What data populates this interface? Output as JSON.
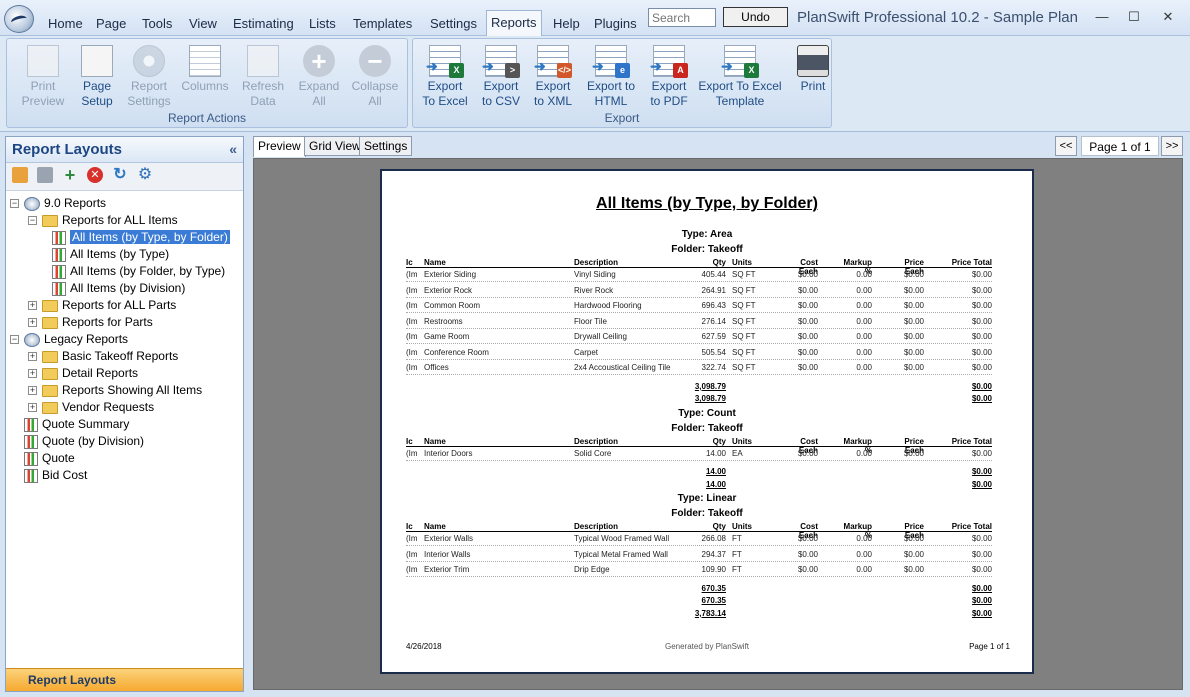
{
  "window": {
    "title": "PlanSwift Professional 10.2 - Sample Plan",
    "minimize": "—",
    "maximize": "☐",
    "close": "✕"
  },
  "menu": {
    "items": [
      "Home",
      "Page",
      "Tools",
      "View",
      "Estimating",
      "Lists",
      "Templates",
      "Settings",
      "Reports",
      "Help",
      "Plugins"
    ],
    "active": "Reports",
    "search_placeholder": "Search",
    "undo_label": "Undo"
  },
  "ribbon": {
    "report_actions": {
      "label": "Report Actions",
      "buttons": [
        {
          "label": "Print\nPreview",
          "icon": "print-preview-icon",
          "enabled": false
        },
        {
          "label": "Page\nSetup",
          "icon": "page-setup-icon",
          "enabled": true
        },
        {
          "label": "Report\nSettings",
          "icon": "report-settings-icon",
          "enabled": false
        },
        {
          "label": "Columns",
          "icon": "columns-icon",
          "enabled": false
        },
        {
          "label": "Refresh\nData",
          "icon": "refresh-data-icon",
          "enabled": false
        },
        {
          "label": "Expand\nAll",
          "icon": "expand-all-icon",
          "enabled": false
        },
        {
          "label": "Collapse\nAll",
          "icon": "collapse-all-icon",
          "enabled": false
        }
      ]
    },
    "export": {
      "label": "Export",
      "buttons": [
        {
          "label": "Export\nTo Excel",
          "icon": "export-excel-icon",
          "badge": "X"
        },
        {
          "label": "Export\nto CSV",
          "icon": "export-csv-icon",
          "badge": ">"
        },
        {
          "label": "Export\nto XML",
          "icon": "export-xml-icon",
          "badge": "</>"
        },
        {
          "label": "Export to\nHTML",
          "icon": "export-html-icon",
          "badge": "e"
        },
        {
          "label": "Export\nto PDF",
          "icon": "export-pdf-icon",
          "badge": "A"
        },
        {
          "label": "Export To Excel\nTemplate",
          "icon": "export-excel-template-icon",
          "badge": "X"
        },
        {
          "label": "Print",
          "icon": "printer-icon",
          "badge": ""
        }
      ]
    }
  },
  "left_panel": {
    "title": "Report Layouts",
    "collapse": "«",
    "footer": "Report Layouts",
    "tree": [
      {
        "label": "9.0 Reports",
        "level": 0,
        "kind": "root",
        "exp": "−"
      },
      {
        "label": "Reports for ALL Items",
        "level": 1,
        "kind": "folder",
        "exp": "−"
      },
      {
        "label": "All Items (by Type, by Folder)",
        "level": 2,
        "kind": "report",
        "selected": true
      },
      {
        "label": "All Items (by Type)",
        "level": 2,
        "kind": "report"
      },
      {
        "label": "All Items (by Folder, by Type)",
        "level": 2,
        "kind": "report"
      },
      {
        "label": "All Items (by Division)",
        "level": 2,
        "kind": "report"
      },
      {
        "label": "Reports for ALL Parts",
        "level": 1,
        "kind": "folder",
        "exp": "+"
      },
      {
        "label": "Reports for Parts",
        "level": 1,
        "kind": "folder",
        "exp": "+"
      },
      {
        "label": "Legacy Reports",
        "level": 0,
        "kind": "root",
        "exp": "−"
      },
      {
        "label": "Basic Takeoff Reports",
        "level": 1,
        "kind": "folder",
        "exp": "+"
      },
      {
        "label": "Detail Reports",
        "level": 1,
        "kind": "folder",
        "exp": "+"
      },
      {
        "label": "Reports Showing All Items",
        "level": 1,
        "kind": "folder",
        "exp": "+"
      },
      {
        "label": "Vendor Requests",
        "level": 1,
        "kind": "folder",
        "exp": "+"
      },
      {
        "label": "Quote Summary",
        "level": 0,
        "kind": "report"
      },
      {
        "label": "Quote (by Division)",
        "level": 0,
        "kind": "report"
      },
      {
        "label": "Quote",
        "level": 0,
        "kind": "report"
      },
      {
        "label": "Bid Cost",
        "level": 0,
        "kind": "report"
      }
    ]
  },
  "content": {
    "tabs": [
      "Preview",
      "Grid View",
      "Settings"
    ],
    "active_tab": "Preview",
    "pager": {
      "prev": "<<",
      "next": ">>",
      "indicator": "Page 1 of 1"
    }
  },
  "report": {
    "title": "All Items (by Type, by Folder)",
    "columns": [
      "Ic",
      "Name",
      "Description",
      "Qty",
      "Units",
      "Cost Each",
      "Markup %",
      "Price Each",
      "Price Total"
    ],
    "sections": [
      {
        "type": "Type: Area",
        "folder": "Folder: Takeoff",
        "rows": [
          [
            "(Im",
            "Exterior Siding",
            "Vinyl Siding",
            "405.44",
            "SQ FT",
            "$0.00",
            "0.00",
            "$0.00",
            "$0.00"
          ],
          [
            "(Im",
            "Exterior Rock",
            "River Rock",
            "264.91",
            "SQ FT",
            "$0.00",
            "0.00",
            "$0.00",
            "$0.00"
          ],
          [
            "(Im",
            "Common Room",
            "Hardwood Flooring",
            "696.43",
            "SQ FT",
            "$0.00",
            "0.00",
            "$0.00",
            "$0.00"
          ],
          [
            "(Im",
            "Restrooms",
            "Floor Tile",
            "276.14",
            "SQ FT",
            "$0.00",
            "0.00",
            "$0.00",
            "$0.00"
          ],
          [
            "(Im",
            "Game Room",
            "Drywall Ceiling",
            "627.59",
            "SQ FT",
            "$0.00",
            "0.00",
            "$0.00",
            "$0.00"
          ],
          [
            "(Im",
            "Conference Room",
            "Carpet",
            "505.54",
            "SQ FT",
            "$0.00",
            "0.00",
            "$0.00",
            "$0.00"
          ],
          [
            "(Im",
            "Offices",
            "2x4 Accoustical Ceiling Tile",
            "322.74",
            "SQ FT",
            "$0.00",
            "0.00",
            "$0.00",
            "$0.00"
          ]
        ],
        "totals": [
          [
            "3,098.79",
            "$0.00"
          ],
          [
            "3,098.79",
            "$0.00"
          ]
        ]
      },
      {
        "type": "Type: Count",
        "folder": "Folder: Takeoff",
        "rows": [
          [
            "(Im",
            "Interior Doors",
            "Solid Core",
            "14.00",
            "EA",
            "$0.00",
            "0.00",
            "$0.00",
            "$0.00"
          ]
        ],
        "totals": [
          [
            "14.00",
            "$0.00"
          ],
          [
            "14.00",
            "$0.00"
          ]
        ]
      },
      {
        "type": "Type: Linear",
        "folder": "Folder: Takeoff",
        "rows": [
          [
            "(Im",
            "Exterior Walls",
            "Typical Wood Framed Wall",
            "266.08",
            "FT",
            "$0.00",
            "0.00",
            "$0.00",
            "$0.00"
          ],
          [
            "(Im",
            "Interior Walls",
            "Typical Metal Framed Wall",
            "294.37",
            "FT",
            "$0.00",
            "0.00",
            "$0.00",
            "$0.00"
          ],
          [
            "(Im",
            "Exterior Trim",
            "Drip Edge",
            "109.90",
            "FT",
            "$0.00",
            "0.00",
            "$0.00",
            "$0.00"
          ]
        ],
        "totals": [
          [
            "670.35",
            "$0.00"
          ],
          [
            "670.35",
            "$0.00"
          ],
          [
            "3,783.14",
            "$0.00"
          ]
        ]
      }
    ],
    "footer": {
      "date": "4/26/2018",
      "generated": "Generated by PlanSwift",
      "page": "Page 1 of 1"
    }
  }
}
